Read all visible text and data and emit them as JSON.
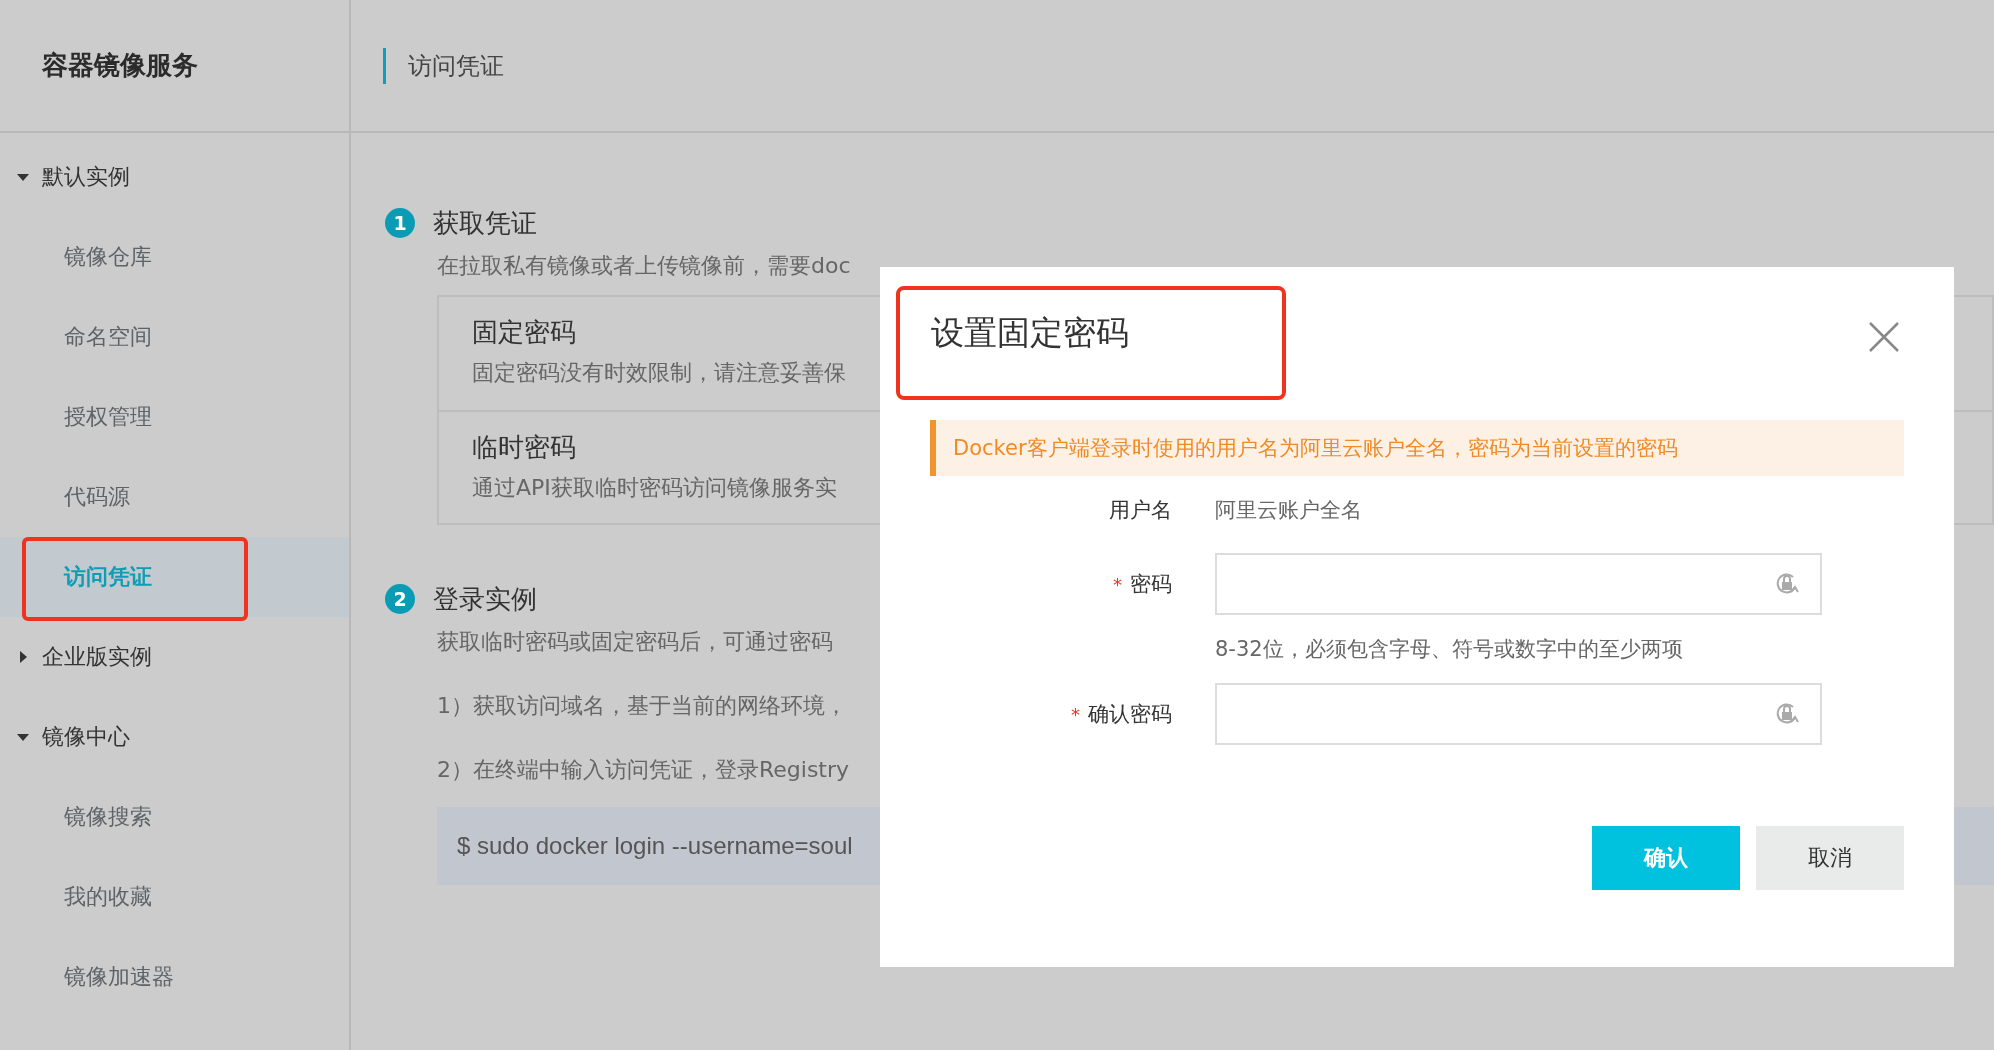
{
  "sidebar": {
    "title": "容器镜像服务",
    "groups": [
      {
        "label": "默认实例",
        "expanded": true,
        "items": [
          {
            "label": "镜像仓库",
            "selected": false,
            "highlighted": false
          },
          {
            "label": "命名空间",
            "selected": false,
            "highlighted": false
          },
          {
            "label": "授权管理",
            "selected": false,
            "highlighted": false
          },
          {
            "label": "代码源",
            "selected": false,
            "highlighted": false
          },
          {
            "label": "访问凭证",
            "selected": true,
            "highlighted": true
          }
        ]
      },
      {
        "label": "企业版实例",
        "expanded": false
      },
      {
        "label": "镜像中心",
        "expanded": true,
        "items": [
          {
            "label": "镜像搜索",
            "selected": false,
            "highlighted": false
          },
          {
            "label": "我的收藏",
            "selected": false,
            "highlighted": false
          },
          {
            "label": "镜像加速器",
            "selected": false,
            "highlighted": false
          }
        ]
      }
    ]
  },
  "header": {
    "title": "访问凭证"
  },
  "steps": [
    {
      "number": "1",
      "title": "获取凭证",
      "description": "在拉取私有镜像或者上传镜像前，需要doc",
      "options": [
        {
          "title": "固定密码",
          "description": "固定密码没有时效限制，请注意妥善保"
        },
        {
          "title": "临时密码",
          "description": "通过API获取临时密码访问镜像服务实"
        }
      ]
    },
    {
      "number": "2",
      "title": "登录实例",
      "description": "获取临时密码或固定密码后，可通过密码",
      "instructions": [
        "1）获取访问域名，基于当前的网络环境，",
        "2）在终端中输入访问凭证，登录Registry"
      ],
      "code": "$ sudo docker login --username=soul"
    }
  ],
  "modal": {
    "title": "设置固定密码",
    "title_highlighted": true,
    "alert": "Docker客户端登录时使用的用户名为阿里云账户全名，密码为当前设置的密码",
    "fields": [
      {
        "kind": "text",
        "label": "用户名",
        "value": "阿里云账户全名"
      },
      {
        "kind": "password",
        "label": "密码",
        "mark": "*",
        "hint": "8-32位，必须包含字母、符号或数字中的至少两项"
      },
      {
        "kind": "password",
        "label": "确认密码",
        "mark": "*"
      }
    ],
    "buttons": [
      {
        "kind": "primary",
        "label": "确认"
      },
      {
        "kind": "secondary",
        "label": "取消"
      }
    ]
  }
}
